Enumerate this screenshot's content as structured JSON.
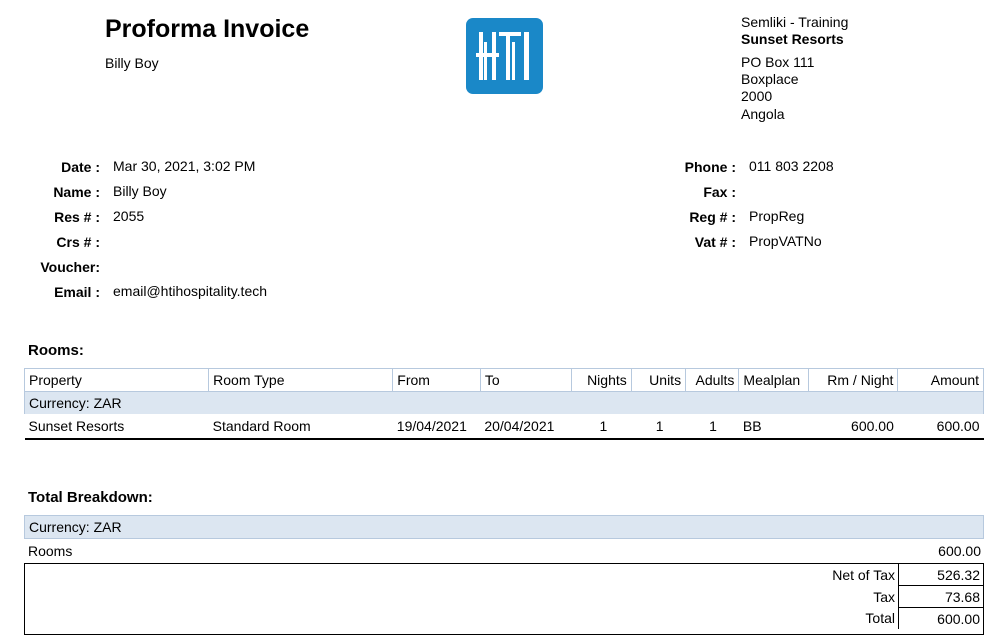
{
  "header": {
    "title": "Proforma Invoice",
    "guest_name": "Billy Boy",
    "logo_text": "HTI",
    "company": "Semliki - Training",
    "property": "Sunset Resorts",
    "address": [
      "PO Box 111",
      "Boxplace",
      "2000",
      "Angola"
    ]
  },
  "details_left": [
    {
      "label": "Date :",
      "value": "Mar 30, 2021, 3:02 PM"
    },
    {
      "label": "Name :",
      "value": "Billy Boy"
    },
    {
      "label": "Res # :",
      "value": "2055"
    },
    {
      "label": "Crs # :",
      "value": ""
    },
    {
      "label": "Voucher:",
      "value": ""
    },
    {
      "label": "Email :",
      "value": "email@htihospitality.tech"
    }
  ],
  "details_right": [
    {
      "label": "Phone :",
      "value": "011 803 2208"
    },
    {
      "label": "Fax :",
      "value": ""
    },
    {
      "label": "Reg # :",
      "value": "PropReg"
    },
    {
      "label": "Vat # :",
      "value": "PropVATNo"
    }
  ],
  "rooms": {
    "title": "Rooms:",
    "columns": [
      "Property",
      "Room Type",
      "From",
      "To",
      "Nights",
      "Units",
      "Adults",
      "Mealplan",
      "Rm / Night",
      "Amount"
    ],
    "currency": "Currency: ZAR",
    "rows": [
      [
        "Sunset Resorts",
        "Standard Room",
        "19/04/2021",
        "20/04/2021",
        "1",
        "1",
        "1",
        "BB",
        "600.00",
        "600.00"
      ]
    ]
  },
  "totals": {
    "title": "Total Breakdown:",
    "currency": "Currency: ZAR",
    "rooms_label": "Rooms",
    "rooms_value": "600.00",
    "lines": [
      {
        "label": "Net of Tax",
        "value": "526.32"
      },
      {
        "label": "Tax",
        "value": "73.68"
      },
      {
        "label": "Total",
        "value": "600.00"
      }
    ]
  }
}
